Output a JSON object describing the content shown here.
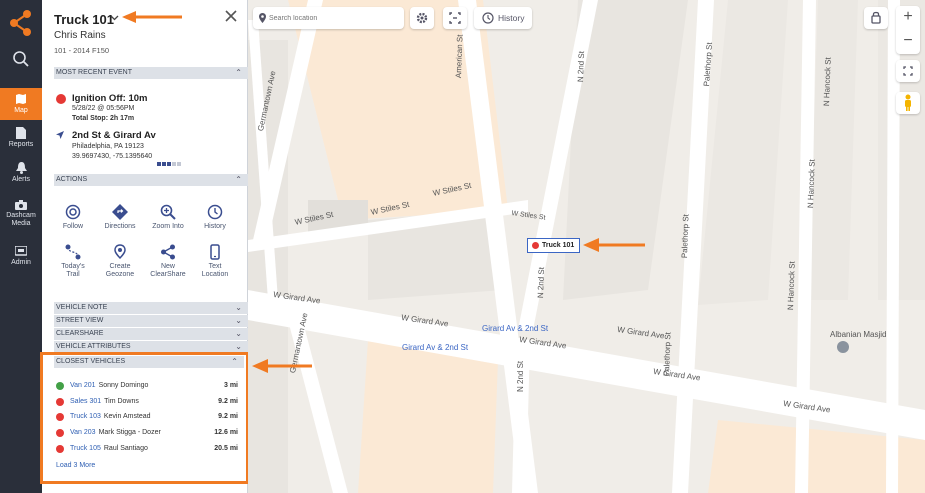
{
  "nav": {
    "items": [
      {
        "label": "Map",
        "icon": "map-icon",
        "active": true
      },
      {
        "label": "Reports",
        "icon": "reports-icon"
      },
      {
        "label": "Alerts",
        "icon": "bell-icon"
      },
      {
        "label": "Dashcam Media",
        "icon": "camera-icon"
      },
      {
        "label": "Admin",
        "icon": "admin-icon"
      }
    ]
  },
  "panel": {
    "title": "Truck 101",
    "driver": "Chris Rains",
    "subtitle": "101 - 2014 F150",
    "sections": {
      "recent": "MOST RECENT EVENT",
      "actions": "ACTIONS",
      "vehicle_note": "VEHICLE NOTE",
      "street_view": "STREET VIEW",
      "clearshare": "CLEARSHARE",
      "vehicle_attributes": "VEHICLE ATTRIBUTES",
      "closest": "CLOSEST VEHICLES"
    },
    "event": {
      "title": "Ignition Off: 10m",
      "datetime": "5/28/22 @ 05:56PM",
      "total_stop": "Total Stop: 2h 17m",
      "location": "2nd St & Girard Av",
      "city": "Philadelphia, PA 19123",
      "coords": "39.9697430, -75.1395640"
    },
    "actions": [
      {
        "label": "Follow",
        "icon": "follow-icon"
      },
      {
        "label": "Directions",
        "icon": "directions-icon"
      },
      {
        "label": "Zoom Into",
        "icon": "zoom-icon"
      },
      {
        "label": "History",
        "icon": "history-icon"
      },
      {
        "label": "Today's Trail",
        "icon": "trail-icon"
      },
      {
        "label": "Create Geozone",
        "icon": "geozone-icon"
      },
      {
        "label": "New ClearShare",
        "icon": "share-icon"
      },
      {
        "label": "Text Location",
        "icon": "phone-icon"
      }
    ],
    "closest_vehicles": [
      {
        "name": "Van 201",
        "driver": "Sonny Domingo",
        "distance": "3 mi",
        "status": "#43a047"
      },
      {
        "name": "Sales 301",
        "driver": "Tim Downs",
        "distance": "9.2 mi",
        "status": "#e53935"
      },
      {
        "name": "Truck 103",
        "driver": "Kevin Amstead",
        "distance": "9.2 mi",
        "status": "#e53935"
      },
      {
        "name": "Van 203",
        "driver": "Mark Stigga - Dozer",
        "distance": "12.6 mi",
        "status": "#e53935"
      },
      {
        "name": "Truck 105",
        "driver": "Raul Santiago",
        "distance": "20.5 mi",
        "status": "#e53935"
      }
    ],
    "load_more": "Load 3 More"
  },
  "map": {
    "search_placeholder": "Search location",
    "history_label": "History",
    "vehicle_label": "Truck 101",
    "streets": {
      "girard1": "W Girard Ave",
      "girard2": "W Girard Ave",
      "girard3": "W Girard Ave",
      "girard4": "W Girard Ave",
      "girard5": "W Girard Ave",
      "girard6": "W Girard Ave",
      "stiles1": "W Stiles St",
      "stiles2": "W Stiles St",
      "stiles3": "W Stiles St",
      "stiles4": "W Stiles St",
      "american": "American St",
      "nd2a": "N 2nd St",
      "nd2b": "N 2nd St",
      "nd2c": "N 2nd St",
      "paleth1": "Palethorp St",
      "paleth2": "Palethorp St",
      "paleth3": "Palethorp St",
      "hancock1": "N Hancock St",
      "hancock2": "N Hancock St",
      "hancock3": "N Hancock St",
      "germantown": "Germantown Ave",
      "germantown2": "Germantown Ave",
      "stx": "N 2nd St"
    },
    "poi_1": "Girard Av & 2nd St",
    "poi_2": "Girard Av & 2nd St",
    "poi_3": "Albanian Masjid"
  },
  "colors": {
    "accent": "#f07a22",
    "nav_bg": "#2a2f3a",
    "link": "#2f5fb3"
  }
}
